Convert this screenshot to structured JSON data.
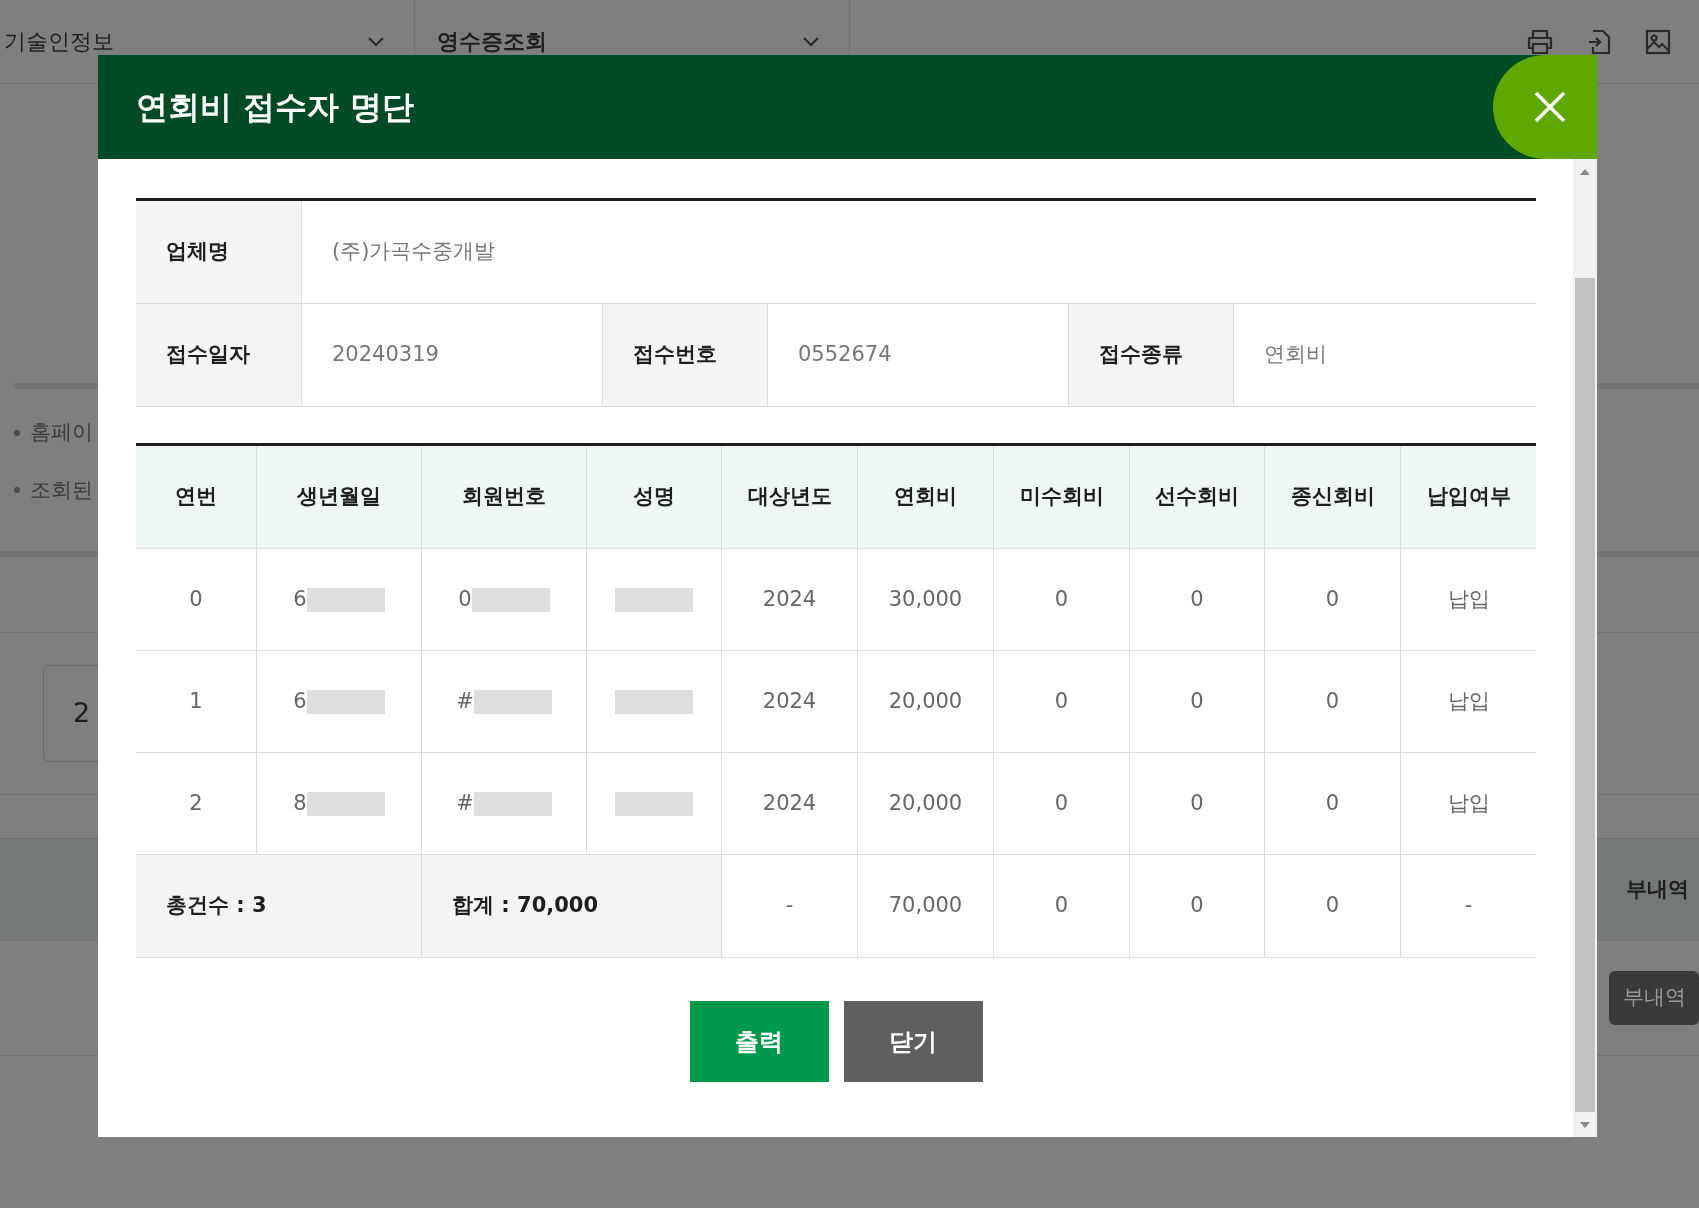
{
  "background": {
    "dropdowns": [
      {
        "label": "기술인정보",
        "bold": false
      },
      {
        "label": "영수증조회",
        "bold": true
      }
    ],
    "notes": [
      "홈페이",
      "조회된"
    ],
    "field_value": "2",
    "column_heading": "부내역",
    "button": "부내역"
  },
  "modal": {
    "title": "연회비 접수자 명단",
    "info_rows": [
      [
        {
          "label": "업체명",
          "value": "(주)가곡수중개발"
        }
      ],
      [
        {
          "label": "접수일자",
          "value": "20240319"
        },
        {
          "label": "접수번호",
          "value": "0552674"
        },
        {
          "label": "접수종류",
          "value": "연회비"
        }
      ]
    ],
    "table": {
      "columns": [
        "연번",
        "생년월일",
        "회원번호",
        "성명",
        "대상년도",
        "연회비",
        "미수회비",
        "선수회비",
        "종신회비",
        "납입여부"
      ],
      "rows": [
        [
          {
            "text": "0"
          },
          {
            "text": "6",
            "redacted": true
          },
          {
            "text": "0",
            "redacted": true
          },
          {
            "redacted": true
          },
          {
            "text": "2024"
          },
          {
            "text": "30,000"
          },
          {
            "text": "0"
          },
          {
            "text": "0"
          },
          {
            "text": "0"
          },
          {
            "text": "납입"
          }
        ],
        [
          {
            "text": "1"
          },
          {
            "text": "6",
            "redacted": true
          },
          {
            "text": "#",
            "redacted": true
          },
          {
            "redacted": true
          },
          {
            "text": "2024"
          },
          {
            "text": "20,000"
          },
          {
            "text": "0"
          },
          {
            "text": "0"
          },
          {
            "text": "0"
          },
          {
            "text": "납입"
          }
        ],
        [
          {
            "text": "2"
          },
          {
            "text": "8",
            "redacted": true
          },
          {
            "text": "#",
            "redacted": true
          },
          {
            "redacted": true
          },
          {
            "text": "2024"
          },
          {
            "text": "20,000"
          },
          {
            "text": "0"
          },
          {
            "text": "0"
          },
          {
            "text": "0"
          },
          {
            "text": "납입"
          }
        ]
      ],
      "totals": [
        {
          "text": "총건수 : 3",
          "kind": "label"
        },
        {
          "text": "합계 : 70,000",
          "kind": "label"
        },
        {
          "text": "-",
          "kind": "value"
        },
        {
          "text": "70,000",
          "kind": "value"
        },
        {
          "text": "0",
          "kind": "value"
        },
        {
          "text": "0",
          "kind": "value"
        },
        {
          "text": "0",
          "kind": "value"
        },
        {
          "text": "-",
          "kind": "value"
        }
      ]
    },
    "buttons": [
      {
        "label": "출력",
        "kind": "primary"
      },
      {
        "label": "닫기",
        "kind": "secondary"
      }
    ]
  }
}
